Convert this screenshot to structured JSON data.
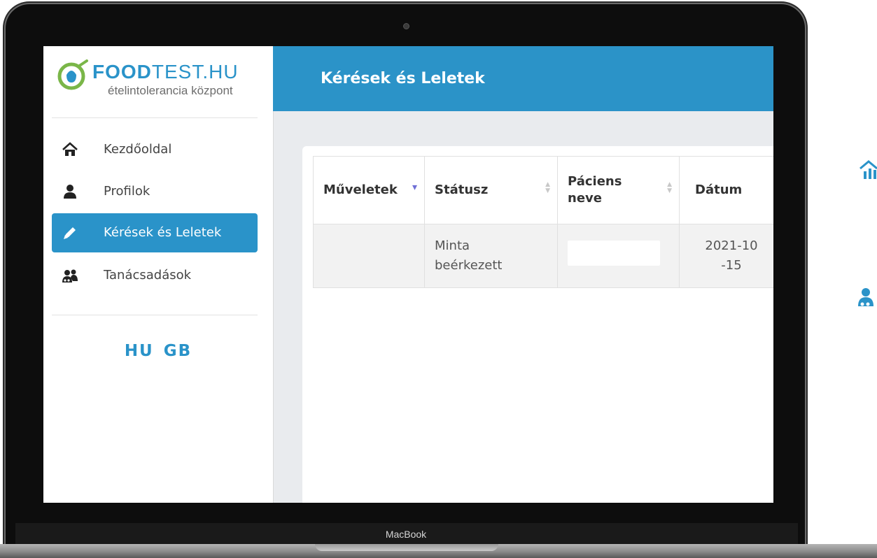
{
  "device": {
    "brand_label": "MacBook"
  },
  "app": {
    "logo": {
      "name_bold": "FOOD",
      "name_light": "TEST.HU",
      "tagline": "ételintolerancia központ"
    },
    "sidebar": {
      "items": [
        {
          "label": "Kezdőoldal",
          "icon": "home-icon",
          "active": false
        },
        {
          "label": "Profilok",
          "icon": "user-icon",
          "active": false
        },
        {
          "label": "Kérések és Leletek",
          "icon": "pencil-icon",
          "active": true
        },
        {
          "label": "Tanácsadások",
          "icon": "consultation-icon",
          "active": false
        }
      ],
      "languages": [
        "HU",
        "GB"
      ]
    },
    "header": {
      "title": "Kérések és Leletek"
    },
    "table": {
      "columns": [
        {
          "label": "Műveletek",
          "sort": "desc"
        },
        {
          "label": "Státusz",
          "sort": "none"
        },
        {
          "label": "Páciens neve",
          "sort": "none"
        },
        {
          "label": "Dátum",
          "sort": "none"
        }
      ],
      "rows": [
        {
          "actions": "",
          "status": "Minta beérkezett",
          "patient_name": "",
          "date": "2021-10-15"
        }
      ]
    }
  },
  "colors": {
    "accent": "#2a93c9",
    "header": "#2b93c8",
    "sort_active": "#6f6fd6"
  }
}
